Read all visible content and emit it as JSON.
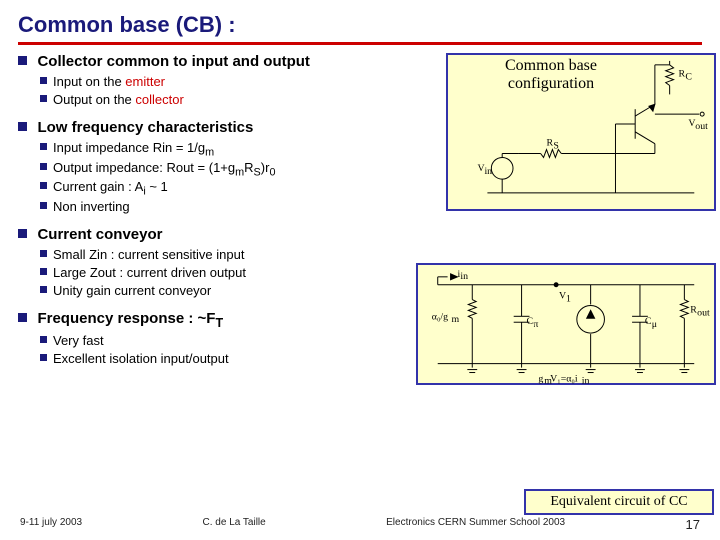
{
  "title": "Common base (CB) :",
  "sections": [
    {
      "label": "Collector common to input and output",
      "items": [
        {
          "pre": "Input on the ",
          "red": "emitter",
          "post": ""
        },
        {
          "pre": "Output on the ",
          "red": "collector",
          "post": ""
        }
      ]
    },
    {
      "label": "Low frequency characteristics",
      "items": [
        {
          "pre": "Input impedance Rin = 1/g",
          "sub": "m",
          "post": ""
        },
        {
          "pre": "Output impedance: Rout = (1+g",
          "sub": "m",
          "post": "R",
          "sub2": "S",
          "post2": ")r",
          "sub3": "0"
        },
        {
          "pre": "Current gain : A",
          "sub": "i",
          "post": " ~ 1"
        },
        {
          "pre": "Non inverting"
        }
      ]
    },
    {
      "label": "Current conveyor",
      "items": [
        {
          "pre": "Small Zin :  current sensitive input"
        },
        {
          "pre": "Large Zout : current driven output"
        },
        {
          "pre": "Unity gain current conveyor"
        }
      ]
    },
    {
      "label": "Frequency response : ~F_T",
      "label_pre": "Frequency response : ~F",
      "label_sub": "T",
      "items": [
        {
          "pre": "Very fast"
        },
        {
          "pre": "Excellent isolation input/output"
        }
      ]
    }
  ],
  "fig1": {
    "caption_l1": "Common base",
    "caption_l2": "configuration",
    "Rc": "R_C",
    "Rs": "R_S",
    "Vin": "V_in",
    "Vout": "V_out"
  },
  "fig2": {
    "iin": "i_in",
    "a0gm": "α₀/g_m",
    "Cpi": "C_π",
    "V1": "V₁",
    "Cmu": "C_μ",
    "Rout": "R_out",
    "src": "g_mV₁=α₀i_in"
  },
  "caption2": "Equivalent circuit of CC",
  "footer": {
    "left": "9-11 july 2003",
    "mid": "C. de La Taille",
    "right": "Electronics CERN Summer School 2003",
    "page": "17"
  }
}
